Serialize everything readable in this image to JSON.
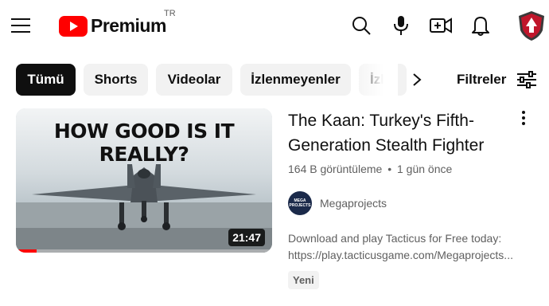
{
  "header": {
    "logo_text": "Premium",
    "country_code": "TR",
    "icons": [
      "menu-icon",
      "search-icon",
      "microphone-icon",
      "create-video-icon",
      "notifications-bell-icon",
      "avatar"
    ],
    "brand_color": "#ff0000"
  },
  "chips": {
    "items": [
      {
        "label": "Tümü",
        "active": true
      },
      {
        "label": "Shorts",
        "active": false
      },
      {
        "label": "Videolar",
        "active": false
      },
      {
        "label": "İzlenmeyenler",
        "active": false
      },
      {
        "label": "İzle",
        "active": false
      }
    ],
    "filters_label": "Filtreler"
  },
  "video": {
    "thumbnail_headline": "HOW GOOD IS IT REALLY?",
    "duration": "21:47",
    "watch_progress": 0.08,
    "title_line1": "The Kaan: Turkey's Fifth-",
    "title_line2": "Generation Stealth Fighter",
    "views": "164 B görüntüleme",
    "separator": "•",
    "age": "1 gün önce",
    "channel_name": "Megaprojects",
    "channel_avatar_text": "MEGA PROJECTS",
    "description_line1": "Download and play Tacticus for Free today:",
    "description_line2": "https://play.tacticusgame.com/Megaprojects...",
    "badge": "Yeni"
  }
}
